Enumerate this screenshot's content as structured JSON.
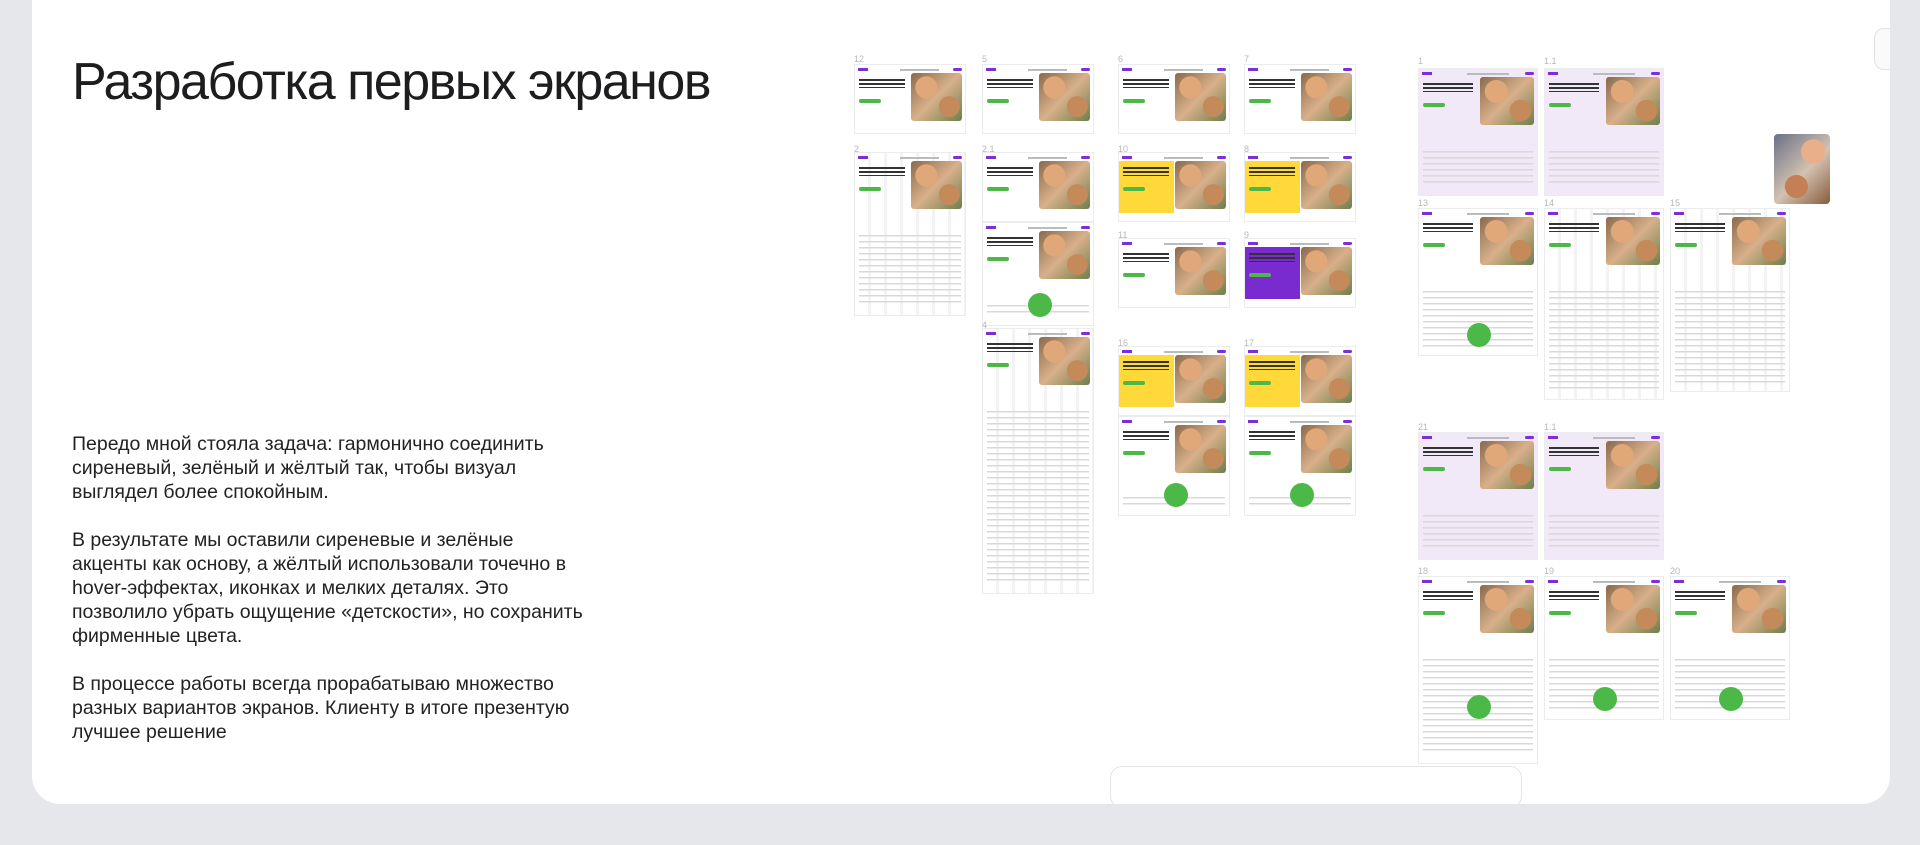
{
  "title": "Разработка первых экранов",
  "paragraphs": [
    "Передо мной стояла задача: гармонично соединить сиреневый, зелёный и жёлтый так, чтобы визуал выглядел более спокойным.",
    "В результате мы оставили сиреневые и зелёные акценты как основу, а жёлтый использовали точечно в hover-эффектах, иконках и мелких деталях. Это позволило убрать ощущение «детскости», но сохранить фирменные цвета.",
    "В процессе работы всегда прорабатываю множество разных вариантов экранов. Клиенту в итоге презентую лучшее решение"
  ],
  "colors": {
    "purple": "#7b2fd6",
    "green": "#4cb848",
    "yellow": "#ffd93a",
    "lilac": "#f1e8f8"
  }
}
